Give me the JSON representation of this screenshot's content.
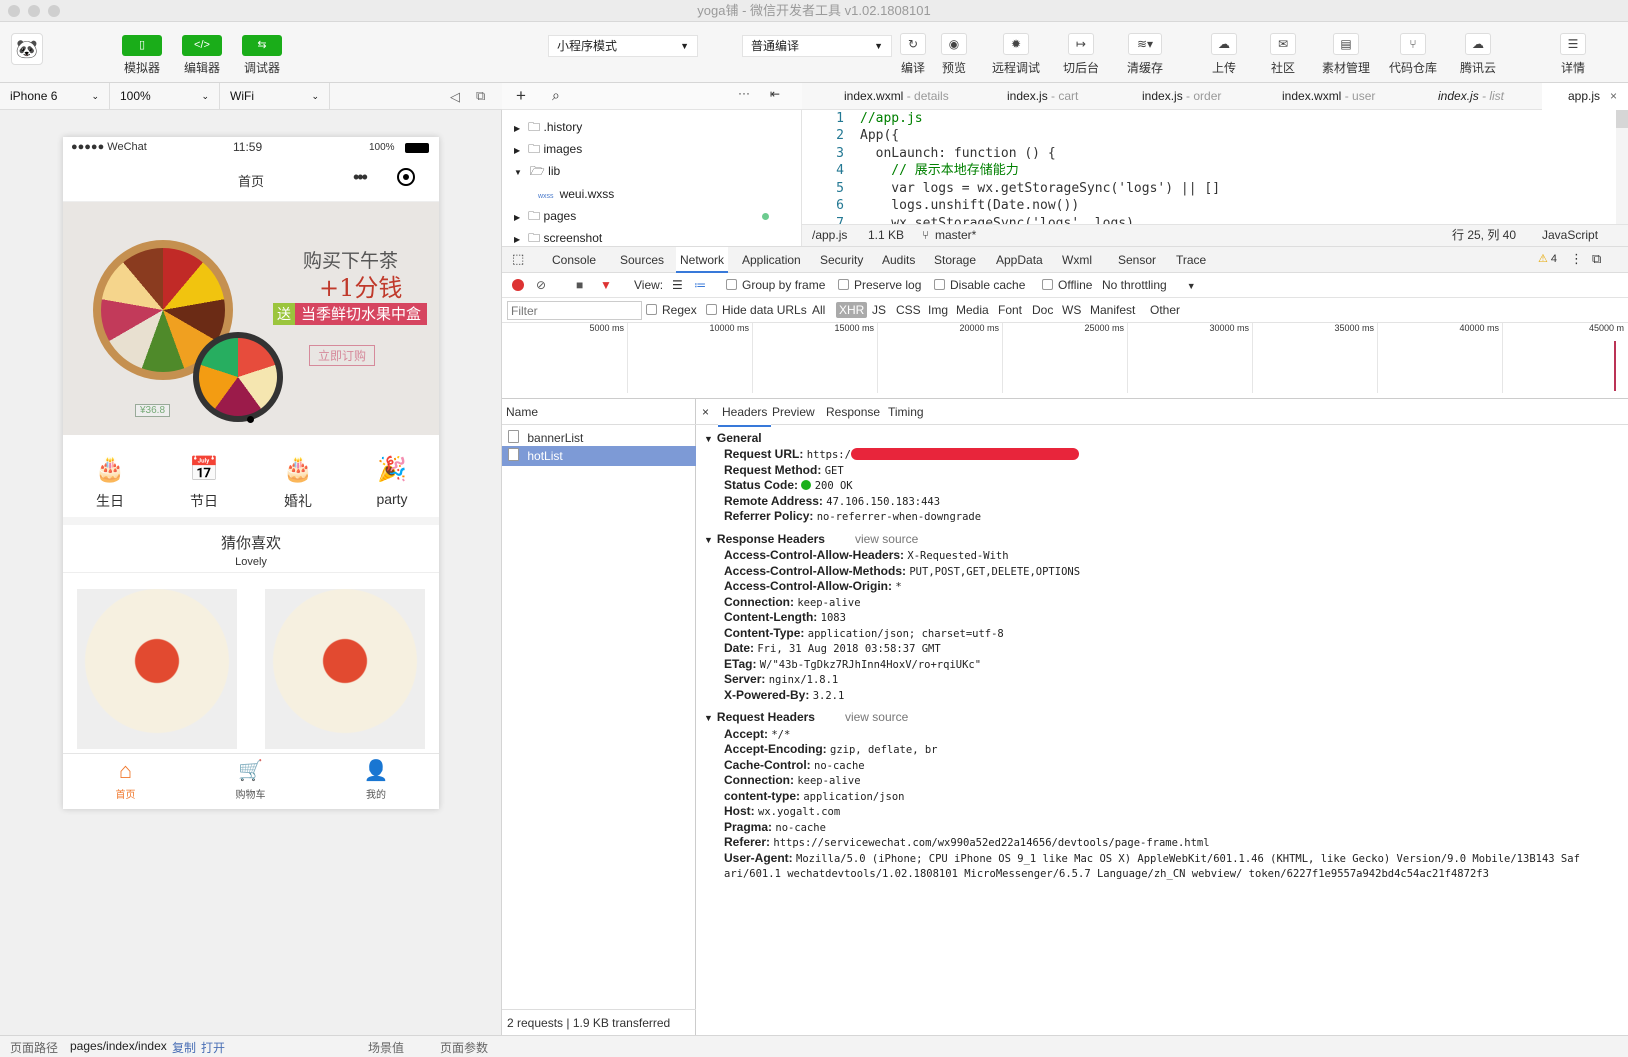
{
  "window": {
    "title": "yoga铺 - 微信开发者工具 v1.02.1808101"
  },
  "toolbar": {
    "left_buttons": [
      "模拟器",
      "编辑器",
      "调试器"
    ],
    "mode_select": "小程序模式",
    "compile_select": "普通编译",
    "right_buttons": [
      "编译",
      "预览",
      "远程调试",
      "切后台",
      "清缓存",
      "上传",
      "社区",
      "素材管理",
      "代码仓库",
      "腾讯云",
      "详情"
    ]
  },
  "simulator": {
    "device": "iPhone 6",
    "zoom": "100%",
    "network": "WiFi",
    "status": {
      "carrier": "●●●●● WeChat",
      "time": "11:59",
      "battery": "100%"
    },
    "nav_title": "首页",
    "banner": {
      "line1": "购买下午茶",
      "line2": "+1分钱",
      "badge": "送",
      "line3": "当季鲜切水果中盒",
      "button": "立即订购",
      "price": "¥36.8"
    },
    "categories": [
      "生日",
      "节日",
      "婚礼",
      "party"
    ],
    "section_title": "猜你喜欢",
    "section_sub": "Lovely",
    "tabbar": [
      "首页",
      "购物车",
      "我的"
    ]
  },
  "files": [
    ".history",
    "images",
    "lib",
    "weui.wxss",
    "pages",
    "screenshot"
  ],
  "editor": {
    "tabs": [
      {
        "name": "index.wxml",
        "sub": " - details"
      },
      {
        "name": "index.js",
        "sub": " - cart"
      },
      {
        "name": "index.js",
        "sub": " - order"
      },
      {
        "name": "index.wxml",
        "sub": " - user"
      },
      {
        "name": "index.js",
        "sub": " - list"
      },
      {
        "name": "app.js",
        "sub": ""
      }
    ],
    "lines": [
      "//app.js",
      "App({",
      "  onLaunch: function () {",
      "    // 展示本地存储能力",
      "    var logs = wx.getStorageSync('logs') || []",
      "    logs.unshift(Date.now())",
      "    wx.setStorageSync('logs', logs)"
    ],
    "status": {
      "path": "/app.js",
      "size": "1.1 KB",
      "branch": "master*",
      "pos": "行 25, 列 40",
      "lang": "JavaScript"
    }
  },
  "devtools": {
    "tabs": [
      "Console",
      "Sources",
      "Network",
      "Application",
      "Security",
      "Audits",
      "Storage",
      "AppData",
      "Wxml",
      "Sensor",
      "Trace"
    ],
    "warn": "4",
    "net_opts": {
      "view": "View:",
      "group": "Group by frame",
      "preserve": "Preserve log",
      "disable": "Disable cache",
      "offline": "Offline",
      "throttle": "No throttling"
    },
    "filter": {
      "placeholder": "Filter",
      "regex": "Regex",
      "hide": "Hide data URLs",
      "types": [
        "All",
        "XHR",
        "JS",
        "CSS",
        "Img",
        "Media",
        "Font",
        "Doc",
        "WS",
        "Manifest",
        "Other"
      ]
    },
    "ticks": [
      "5000 ms",
      "10000 ms",
      "15000 ms",
      "20000 ms",
      "25000 ms",
      "30000 ms",
      "35000 ms",
      "40000 ms",
      "45000 m"
    ],
    "list_header": "Name",
    "requests": [
      "bannerList",
      "hotList"
    ],
    "footer": "2 requests | 1.9 KB transferred",
    "detail_tabs": [
      "Headers",
      "Preview",
      "Response",
      "Timing"
    ],
    "general": {
      "title": "General",
      "items": [
        [
          "Request URL:",
          "https:/"
        ],
        [
          "Request Method:",
          "GET"
        ],
        [
          "Status Code:",
          "200 OK"
        ],
        [
          "Remote Address:",
          "47.106.150.183:443"
        ],
        [
          "Referrer Policy:",
          "no-referrer-when-downgrade"
        ]
      ]
    },
    "response": {
      "title": "Response Headers",
      "view": "view source",
      "items": [
        [
          "Access-Control-Allow-Headers:",
          "X-Requested-With"
        ],
        [
          "Access-Control-Allow-Methods:",
          "PUT,POST,GET,DELETE,OPTIONS"
        ],
        [
          "Access-Control-Allow-Origin:",
          "*"
        ],
        [
          "Connection:",
          "keep-alive"
        ],
        [
          "Content-Length:",
          "1083"
        ],
        [
          "Content-Type:",
          "application/json; charset=utf-8"
        ],
        [
          "Date:",
          "Fri, 31 Aug 2018 03:58:37 GMT"
        ],
        [
          "ETag:",
          "W/\"43b-TgDkz7RJhInn4HoxV/ro+rqiUKc\""
        ],
        [
          "Server:",
          "nginx/1.8.1"
        ],
        [
          "X-Powered-By:",
          "3.2.1"
        ]
      ]
    },
    "request": {
      "title": "Request Headers",
      "view": "view source",
      "items": [
        [
          "Accept:",
          "*/*"
        ],
        [
          "Accept-Encoding:",
          "gzip, deflate, br"
        ],
        [
          "Cache-Control:",
          "no-cache"
        ],
        [
          "Connection:",
          "keep-alive"
        ],
        [
          "content-type:",
          "application/json"
        ],
        [
          "Host:",
          "wx.yogalt.com"
        ],
        [
          "Pragma:",
          "no-cache"
        ],
        [
          "Referer:",
          "https://servicewechat.com/wx990a52ed22a14656/devtools/page-frame.html"
        ],
        [
          "User-Agent:",
          "Mozilla/5.0 (iPhone; CPU iPhone OS 9_1 like Mac OS X) AppleWebKit/601.1.46 (KHTML, like Gecko) Version/9.0 Mobile/13B143 Saf"
        ]
      ],
      "ua_cont": "ari/601.1 wechatdevtools/1.02.1808101 MicroMessenger/6.5.7 Language/zh_CN webview/ token/6227f1e9557a942bd4c54ac21f4872f3"
    }
  },
  "statusbar": {
    "path_label": "页面路径",
    "path": "pages/index/index",
    "copy": "复制",
    "open": "打开",
    "scene": "场景值",
    "params": "页面参数"
  }
}
